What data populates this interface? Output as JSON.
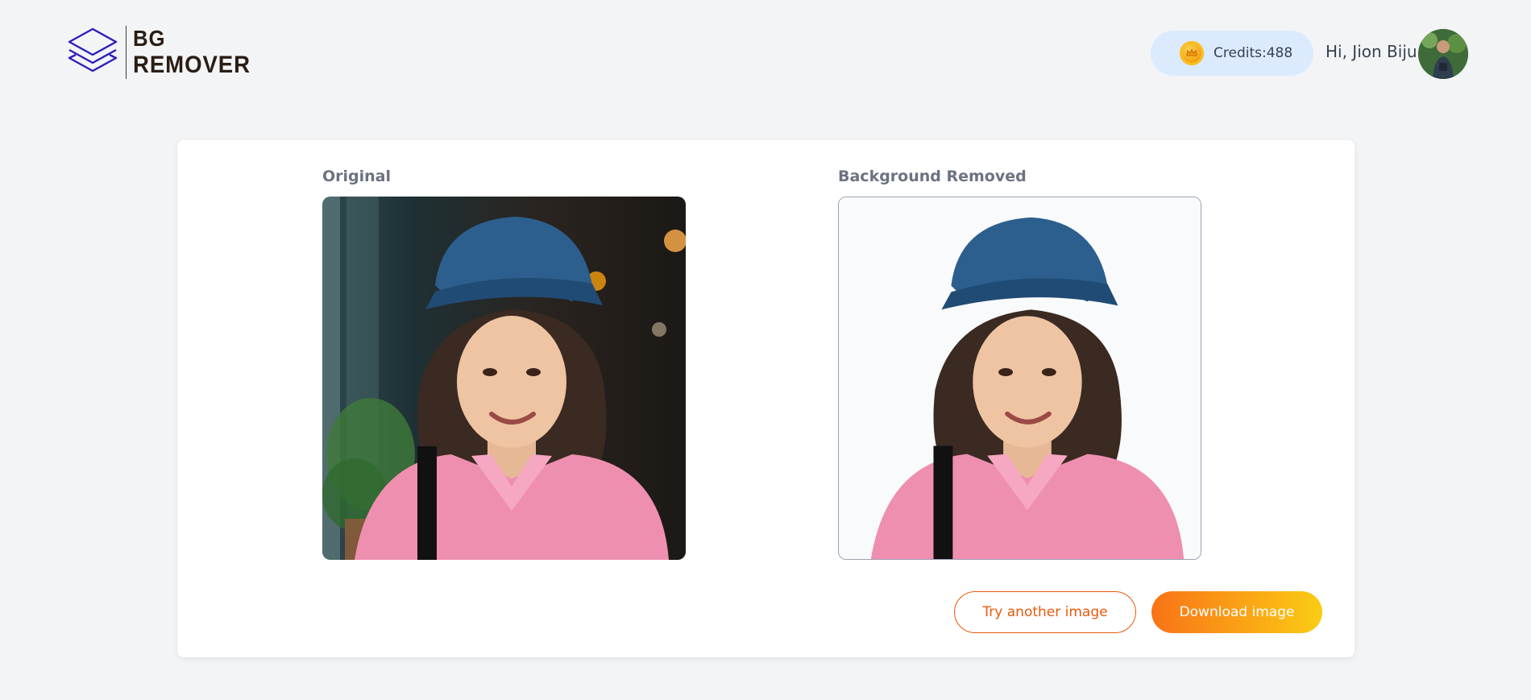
{
  "brand": {
    "line1": "BG",
    "line2": "REMOVER",
    "color": "#2a1d14",
    "mark_color": "#2d1fb8"
  },
  "header": {
    "credits_label": "Credits:488",
    "greeting": "Hi, Jion Biju",
    "coin_icon": "crown-coin-icon",
    "avatar_icon": "user-avatar"
  },
  "result": {
    "original_label": "Original",
    "removed_label": "Background Removed"
  },
  "actions": {
    "try_another": "Try another image",
    "download": "Download image"
  },
  "colors": {
    "accent": "#ea580c",
    "gradient_start": "#f97316",
    "gradient_end": "#facc15",
    "credits_bg": "#dbeafe"
  }
}
